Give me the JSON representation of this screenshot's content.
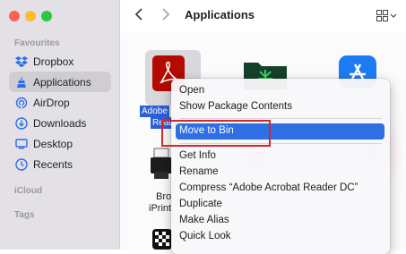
{
  "window": {
    "title": "Applications",
    "back_icon": "chevron-left-icon",
    "forward_icon": "chevron-right-icon",
    "view_icon": "grid-view-icon"
  },
  "sidebar": {
    "favourites_label": "Favourites",
    "items": [
      {
        "label": "Dropbox",
        "icon": "dropbox-icon"
      },
      {
        "label": "Applications",
        "icon": "applications-icon",
        "selected": true
      },
      {
        "label": "AirDrop",
        "icon": "airdrop-icon"
      },
      {
        "label": "Downloads",
        "icon": "downloads-icon"
      },
      {
        "label": "Desktop",
        "icon": "desktop-icon"
      },
      {
        "label": "Recents",
        "icon": "recents-icon"
      }
    ],
    "icloud_label": "iCloud",
    "tags_label": "Tags"
  },
  "files": {
    "selected_name_line1": "Adobe",
    "selected_name_line2": "Read",
    "partial_name_line1": "Bro",
    "partial_name_line2": "iPrint"
  },
  "context_menu": {
    "items": [
      {
        "label": "Open"
      },
      {
        "label": "Show Package Contents"
      },
      {
        "label": "Move to Bin",
        "highlighted": true
      },
      {
        "label": "Get Info"
      },
      {
        "label": "Rename"
      },
      {
        "label": "Compress “Adobe Acrobat Reader DC”"
      },
      {
        "label": "Duplicate"
      },
      {
        "label": "Make Alias"
      },
      {
        "label": "Quick Look"
      }
    ]
  },
  "colors": {
    "selection_blue": "#2f6fe6",
    "annotation_red": "#d7262b",
    "acrobat_red": "#b30b00"
  }
}
